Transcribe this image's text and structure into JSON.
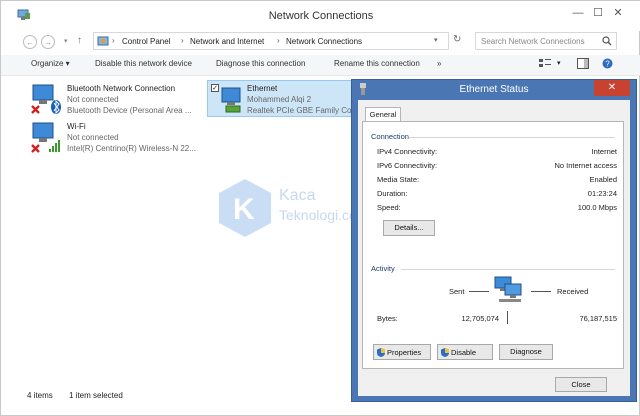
{
  "window": {
    "title": "Network Connections",
    "breadcrumb": [
      "Control Panel",
      "Network and Internet",
      "Network Connections"
    ],
    "search_placeholder": "Search Network Connections"
  },
  "toolbar": {
    "organize": "Organize ▾",
    "disable": "Disable this network device",
    "diagnose": "Diagnose this connection",
    "rename": "Rename this connection",
    "more": "»"
  },
  "connections": [
    {
      "name": "Bluetooth Network Connection",
      "status": "Not connected",
      "device": "Bluetooth Device (Personal Area ..."
    },
    {
      "name": "Ethernet",
      "status": "Mohammed Alqi  2",
      "device": "Realtek PCIe GBE Family Co"
    },
    {
      "name": "Wi-Fi",
      "status": "Not connected",
      "device": "Intel(R) Centrino(R) Wireless-N 22..."
    }
  ],
  "statusbar": {
    "count": "4 items",
    "selected": "1 item selected"
  },
  "watermark": {
    "line1": "Kaca",
    "line2": "Teknologi.com"
  },
  "dialog": {
    "title": "Ethernet Status",
    "close_x": "✕",
    "tab": "General",
    "connection_header": "Connection",
    "rows": [
      {
        "label": "IPv4 Connectivity:",
        "value": "Internet"
      },
      {
        "label": "IPv6 Connectivity:",
        "value": "No Internet access"
      },
      {
        "label": "Media State:",
        "value": "Enabled"
      },
      {
        "label": "Duration:",
        "value": "01:23:24"
      },
      {
        "label": "Speed:",
        "value": "100.0 Mbps"
      }
    ],
    "details_btn": "Details...",
    "activity_header": "Activity",
    "sent_label": "Sent",
    "received_label": "Received",
    "bytes_label": "Bytes:",
    "bytes_sent": "12,705,074",
    "bytes_received": "76,187,515",
    "properties_btn": "Properties",
    "disable_btn": "Disable",
    "diagnose_btn": "Diagnose",
    "close_btn": "Close"
  }
}
